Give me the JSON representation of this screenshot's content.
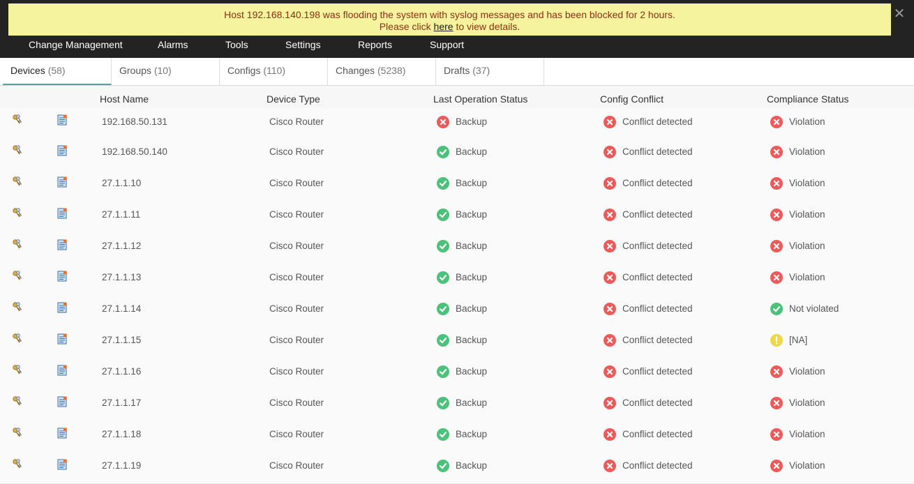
{
  "banner": {
    "line1": "Host 192.168.140.198 was flooding the system with syslog messages and has been blocked for 2 hours.",
    "line2_prefix": "Please click ",
    "link_text": "here",
    "line2_suffix": " to view details.",
    "close_symbol": "✕"
  },
  "nav": {
    "items": [
      "Change Management",
      "Alarms",
      "Tools",
      "Settings",
      "Reports",
      "Support"
    ]
  },
  "tabs": [
    {
      "label": "Devices",
      "count": "(58)"
    },
    {
      "label": "Groups",
      "count": "(10)"
    },
    {
      "label": "Configs",
      "count": "(110)"
    },
    {
      "label": "Changes",
      "count": "(5238)"
    },
    {
      "label": "Drafts",
      "count": "(37)"
    }
  ],
  "table": {
    "headers": [
      "Host Name",
      "Device Type",
      "Last Operation Status",
      "Config Conflict",
      "Compliance Status"
    ],
    "rows": [
      {
        "host": "192.168.50.131",
        "type": "Cisco Router",
        "op": "Backup",
        "op_state": "error",
        "conflict": "Conflict detected",
        "conflict_state": "error",
        "compliance": "Violation",
        "compliance_state": "error"
      },
      {
        "host": "192.168.50.140",
        "type": "Cisco Router",
        "op": "Backup",
        "op_state": "ok",
        "conflict": "Conflict detected",
        "conflict_state": "error",
        "compliance": "Violation",
        "compliance_state": "error"
      },
      {
        "host": "27.1.1.10",
        "type": "Cisco Router",
        "op": "Backup",
        "op_state": "ok",
        "conflict": "Conflict detected",
        "conflict_state": "error",
        "compliance": "Violation",
        "compliance_state": "error"
      },
      {
        "host": "27.1.1.11",
        "type": "Cisco Router",
        "op": "Backup",
        "op_state": "ok",
        "conflict": "Conflict detected",
        "conflict_state": "error",
        "compliance": "Violation",
        "compliance_state": "error"
      },
      {
        "host": "27.1.1.12",
        "type": "Cisco Router",
        "op": "Backup",
        "op_state": "ok",
        "conflict": "Conflict detected",
        "conflict_state": "error",
        "compliance": "Violation",
        "compliance_state": "error"
      },
      {
        "host": "27.1.1.13",
        "type": "Cisco Router",
        "op": "Backup",
        "op_state": "ok",
        "conflict": "Conflict detected",
        "conflict_state": "error",
        "compliance": "Violation",
        "compliance_state": "error"
      },
      {
        "host": "27.1.1.14",
        "type": "Cisco Router",
        "op": "Backup",
        "op_state": "ok",
        "conflict": "Conflict detected",
        "conflict_state": "error",
        "compliance": "Not violated",
        "compliance_state": "ok"
      },
      {
        "host": "27.1.1.15",
        "type": "Cisco Router",
        "op": "Backup",
        "op_state": "ok",
        "conflict": "Conflict detected",
        "conflict_state": "error",
        "compliance": "[NA]",
        "compliance_state": "warn"
      },
      {
        "host": "27.1.1.16",
        "type": "Cisco Router",
        "op": "Backup",
        "op_state": "ok",
        "conflict": "Conflict detected",
        "conflict_state": "error",
        "compliance": "Violation",
        "compliance_state": "error"
      },
      {
        "host": "27.1.1.17",
        "type": "Cisco Router",
        "op": "Backup",
        "op_state": "ok",
        "conflict": "Conflict detected",
        "conflict_state": "error",
        "compliance": "Violation",
        "compliance_state": "error"
      },
      {
        "host": "27.1.1.18",
        "type": "Cisco Router",
        "op": "Backup",
        "op_state": "ok",
        "conflict": "Conflict detected",
        "conflict_state": "error",
        "compliance": "Violation",
        "compliance_state": "error"
      },
      {
        "host": "27.1.1.19",
        "type": "Cisco Router",
        "op": "Backup",
        "op_state": "ok",
        "conflict": "Conflict detected",
        "conflict_state": "error",
        "compliance": "Violation",
        "compliance_state": "error"
      }
    ]
  },
  "icons": {
    "row_action_1": "keys-icon",
    "row_action_2": "config-file-icon",
    "ok": "check-circle-icon",
    "error": "x-circle-icon",
    "warn": "exclamation-circle-icon"
  },
  "colors": {
    "banner_bg": "#f6f39e",
    "banner_text": "#8a2e14",
    "nav_bg": "#232323",
    "ok": "#4cc17a",
    "error": "#ec5a5a",
    "warn": "#ecd84a",
    "active_tab_underline": "#5aa09a"
  }
}
